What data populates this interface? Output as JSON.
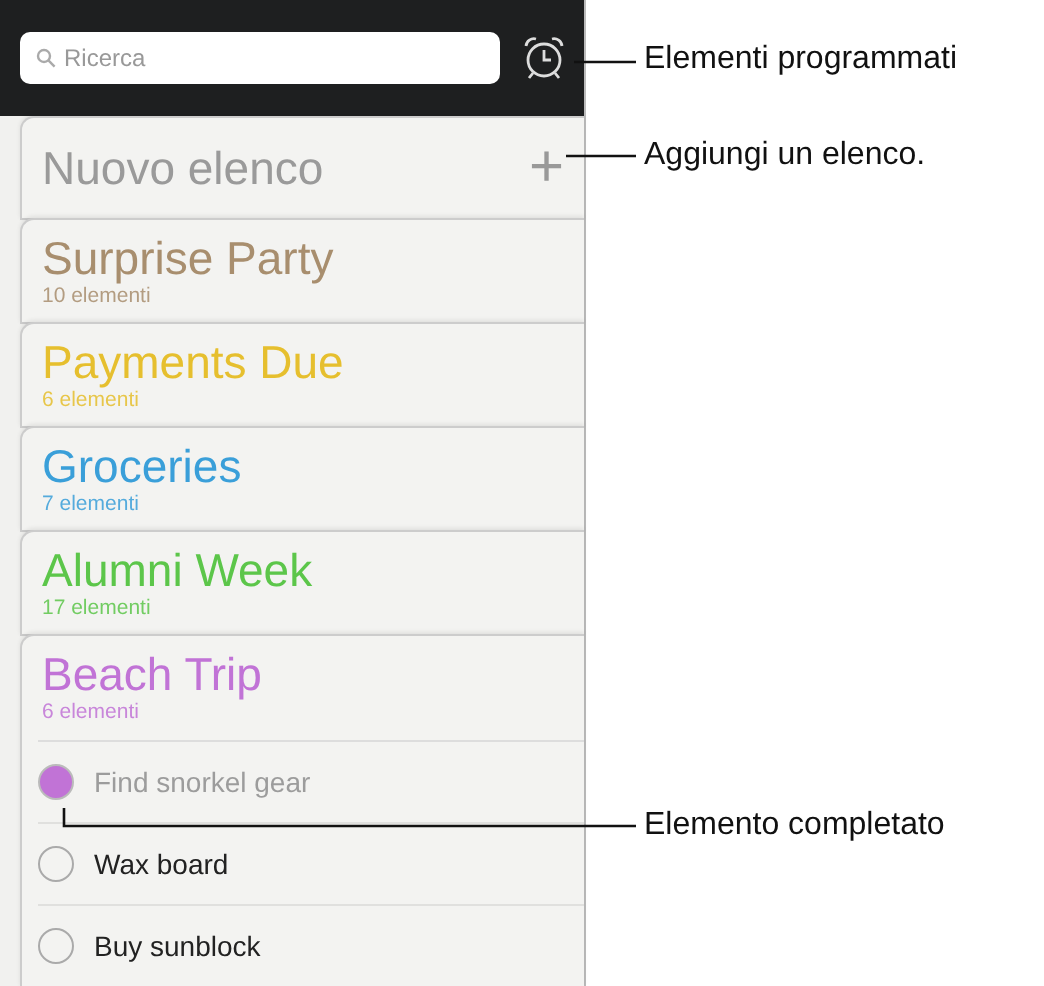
{
  "search": {
    "placeholder": "Ricerca"
  },
  "new_list": {
    "label": "Nuovo elenco",
    "add": "+"
  },
  "lists": [
    {
      "name": "Surprise Party",
      "count": "10 elementi",
      "color": "#a88e6e"
    },
    {
      "name": "Payments Due",
      "count": "6 elementi",
      "color": "#e6bf2e"
    },
    {
      "name": "Groceries",
      "count": "7 elementi",
      "color": "#3a9fd9"
    },
    {
      "name": "Alumni Week",
      "count": "17 elementi",
      "color": "#5cc64a"
    },
    {
      "name": "Beach Trip",
      "count": "6 elementi",
      "color": "#c173d6",
      "items": [
        {
          "text": "Find snorkel gear",
          "completed": true
        },
        {
          "text": "Wax board",
          "completed": false
        },
        {
          "text": "Buy sunblock",
          "completed": false
        }
      ]
    }
  ],
  "callouts": [
    {
      "text": "Elementi programmati"
    },
    {
      "text": "Aggiungi un elenco."
    },
    {
      "text": "Elemento completato"
    }
  ]
}
